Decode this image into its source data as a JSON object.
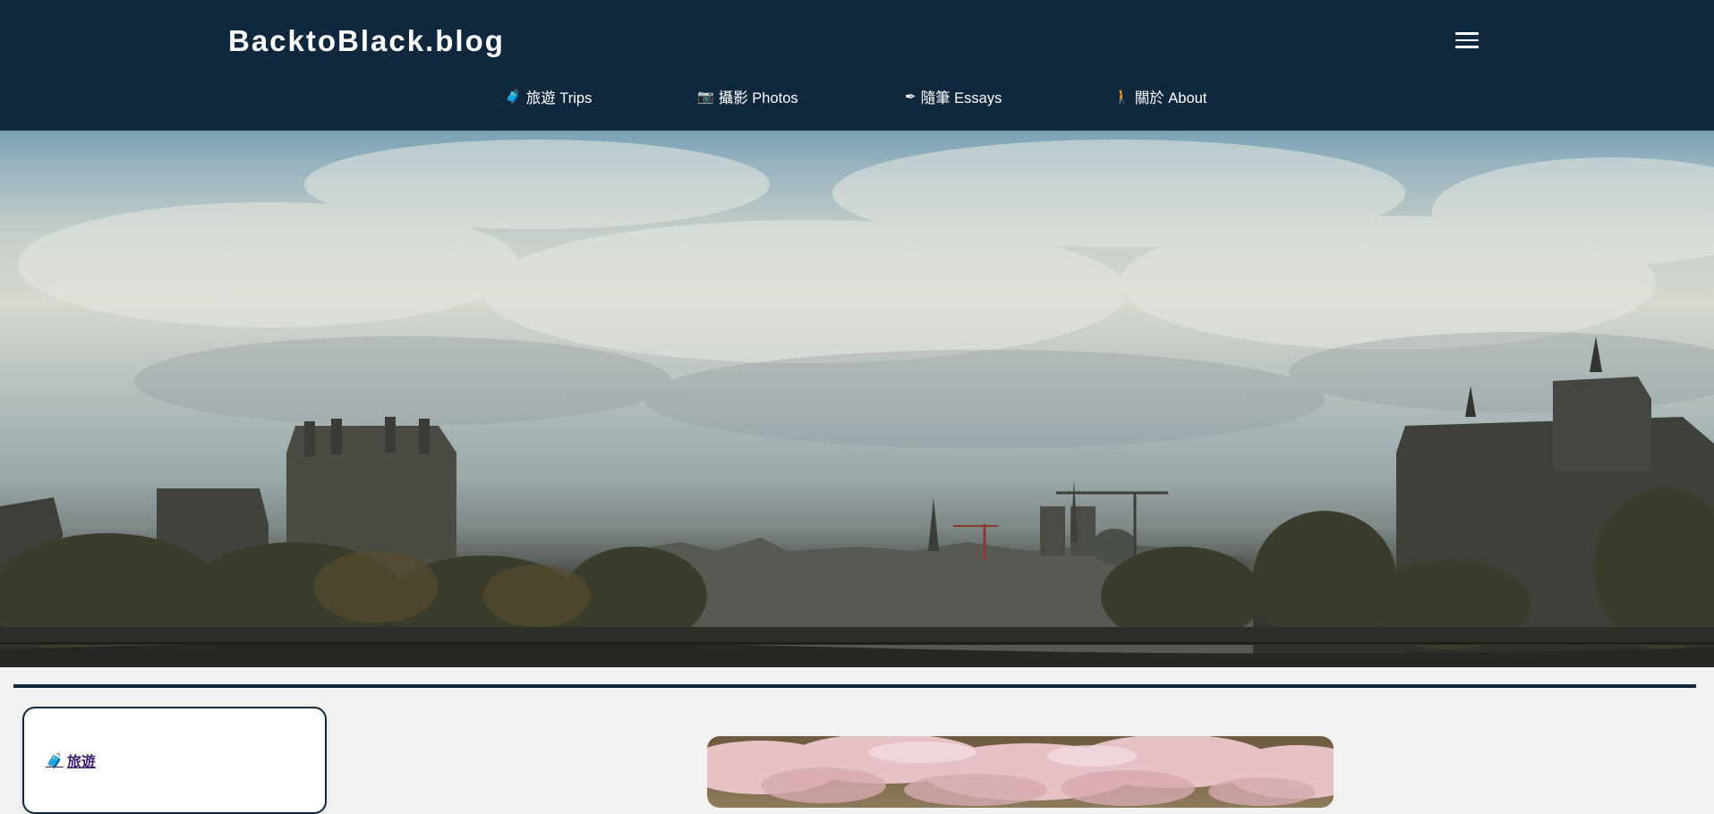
{
  "site": {
    "title": "BacktoBlack.blog"
  },
  "nav": {
    "items": [
      {
        "icon": "luggage-icon",
        "emoji": "🧳",
        "label": "旅遊 Trips"
      },
      {
        "icon": "camera-icon",
        "emoji": "📷",
        "label": "攝影 Photos"
      },
      {
        "icon": "pen-icon",
        "emoji": "✒",
        "label": "隨筆 Essays"
      },
      {
        "icon": "person-icon",
        "emoji": "🚶",
        "label": "關於 About"
      }
    ]
  },
  "sidebar": {
    "link": {
      "icon": "luggage-icon",
      "emoji": "🧳",
      "label": "旅遊"
    }
  },
  "colors": {
    "header_bg": "#0f283d",
    "page_bg": "#f2f2f2",
    "link": "#3a1f6e"
  },
  "icons": {
    "menu": "hamburger-menu-icon"
  }
}
